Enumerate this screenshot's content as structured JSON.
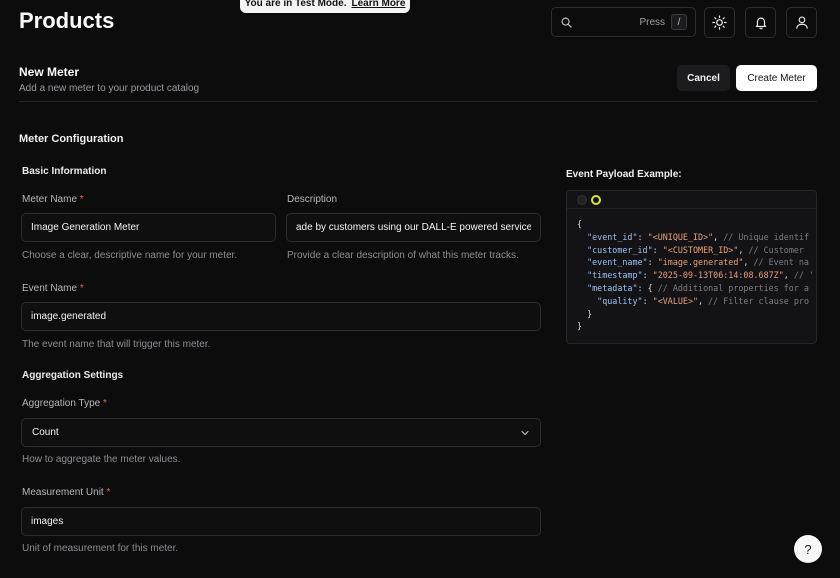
{
  "banner": {
    "text": "You are in Test Mode.",
    "link": "Learn More"
  },
  "header": {
    "title": "Products",
    "search_placeholder": "Press",
    "search_shortcut": "/",
    "icons": [
      "search-icon",
      "sun-icon",
      "bell-icon",
      "user-icon"
    ]
  },
  "page": {
    "title": "New Meter",
    "subtitle": "Add a new meter to your product catalog",
    "cancel_label": "Cancel",
    "create_label": "Create Meter"
  },
  "config": {
    "section_title": "Meter Configuration",
    "basic_title": "Basic Information",
    "meter_name": {
      "label": "Meter Name",
      "required": "*",
      "value": "Image Generation Meter",
      "help": "Choose a clear, descriptive name for your meter."
    },
    "description": {
      "label": "Description",
      "value": "ade by customers using our DALL-E powered service",
      "help": "Provide a clear description of what this meter tracks."
    },
    "event_name": {
      "label": "Event Name",
      "required": "*",
      "value": "image.generated",
      "help": "The event name that will trigger this meter."
    },
    "aggregation_title": "Aggregation Settings",
    "aggregation_type": {
      "label": "Aggregation Type",
      "required": "*",
      "value": "Count",
      "help": "How to aggregate the meter values."
    },
    "measurement_unit": {
      "label": "Measurement Unit",
      "required": "*",
      "value": "images",
      "help": "Unit of measurement for this meter."
    }
  },
  "payload": {
    "title": "Event Payload Example:",
    "lines": {
      "open": "{",
      "event_id_key": "\"event_id\"",
      "event_id_val": "\"<UNIQUE_ID>\"",
      "event_id_comment": "// Unique identif",
      "customer_id_key": "\"customer_id\"",
      "customer_id_val": "\"<CUSTOMER_ID>\"",
      "customer_id_comment": "// Customer",
      "event_name_key": "\"event_name\"",
      "event_name_val": "\"image.generated\"",
      "event_name_comment": "// Event na",
      "timestamp_key": "\"timestamp\"",
      "timestamp_val": "\"2025-09-13T06:14:08.687Z\"",
      "timestamp_comment": "// '",
      "metadata_key": "\"metadata\"",
      "metadata_comment": "// Additional properties for a",
      "quality_key": "\"quality\"",
      "quality_val": "\"<VALUE>\"",
      "quality_comment": "// Filter clause pro",
      "inner_close": "}",
      "close": "}"
    }
  },
  "help_button": "?"
}
